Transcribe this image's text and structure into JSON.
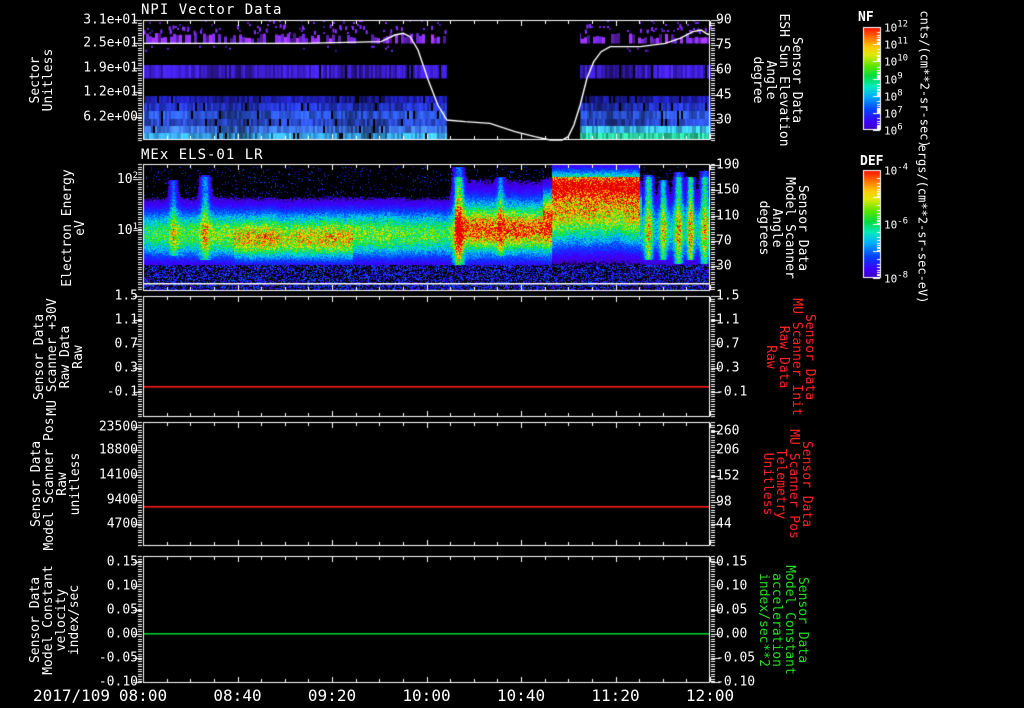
{
  "colors": {
    "background": "#000000",
    "axis": "#ffffff",
    "red_series": "#ff2222",
    "green_series": "#22dd44"
  },
  "x_axis": {
    "date_label": "2017/109",
    "tick_labels": [
      "08:00",
      "08:40",
      "09:20",
      "10:00",
      "10:40",
      "11:20",
      "12:00"
    ],
    "minor_ticks_per_major": 4
  },
  "chart_data": [
    {
      "id": "npi-vector-data",
      "type": "heatmap",
      "title": "NPI Vector Data",
      "y_left": {
        "title_lines": [
          "Sector",
          "Unitless"
        ],
        "ticks": [
          [
            "3.1e+01",
            0.0
          ],
          [
            "2.5e+01",
            0.192
          ],
          [
            "1.9e+01",
            0.4
          ],
          [
            "1.2e+01",
            0.6
          ],
          [
            "6.2e+00",
            0.808
          ]
        ]
      },
      "y_right": {
        "title_lines": [
          "Sensor Data",
          "ESH Sun Elevation",
          "Angle",
          "degree"
        ],
        "color": "#ffffff",
        "ticks": [
          [
            "90",
            0.0
          ],
          [
            "75",
            0.208
          ],
          [
            "60",
            0.417
          ],
          [
            "45",
            0.625
          ],
          [
            "30",
            0.833
          ]
        ]
      },
      "data_gap_time_frac": [
        0.536,
        0.771
      ],
      "overlay_line": {
        "name": "sun-elevation-angle",
        "color": "#ffffff",
        "units": "degree",
        "points_time_frac_deg": [
          [
            0,
            76
          ],
          [
            0.28,
            76
          ],
          [
            0.42,
            77
          ],
          [
            0.444,
            81
          ],
          [
            0.459,
            82
          ],
          [
            0.471,
            80
          ],
          [
            0.485,
            72
          ],
          [
            0.503,
            54
          ],
          [
            0.52,
            39
          ],
          [
            0.536,
            30
          ],
          [
            0.568,
            29
          ],
          [
            0.612,
            28
          ],
          [
            0.656,
            23
          ],
          [
            0.691,
            20
          ],
          [
            0.718,
            18
          ],
          [
            0.739,
            18
          ],
          [
            0.75,
            20
          ],
          [
            0.76,
            27
          ],
          [
            0.771,
            39
          ],
          [
            0.783,
            55
          ],
          [
            0.795,
            65
          ],
          [
            0.808,
            71
          ],
          [
            0.824,
            74
          ],
          [
            0.877,
            74
          ],
          [
            0.921,
            76
          ],
          [
            0.947,
            79
          ],
          [
            0.97,
            83
          ],
          [
            0.984,
            84
          ],
          [
            0.993,
            82
          ],
          [
            1.0,
            81
          ]
        ]
      },
      "bands": [
        {
          "y_frac": [
            0.0,
            0.105
          ],
          "style": "sparse-dots",
          "color": "#6a22dd"
        },
        {
          "y_frac": [
            0.108,
            0.196
          ],
          "style": "dashes",
          "color": "#7a2ae8"
        },
        {
          "y_frac": [
            0.215,
            0.25
          ],
          "style": "sparse-dots",
          "color": "#5a1ecc"
        },
        {
          "y_frac": [
            0.375,
            0.487
          ],
          "style": "noisy",
          "color": "#3c1ecc"
        },
        {
          "y_frac": [
            0.633,
            0.692
          ],
          "style": "noisy",
          "color": "#1d1daa"
        },
        {
          "y_frac": [
            0.692,
            0.758
          ],
          "style": "noisy",
          "color": "#2334c4"
        },
        {
          "y_frac": [
            0.758,
            0.825
          ],
          "style": "noisy",
          "color": "#2c55dc"
        },
        {
          "y_frac": [
            0.825,
            0.883
          ],
          "style": "noisy",
          "color": "#2a49cc"
        },
        {
          "y_frac": [
            0.883,
            0.942
          ],
          "style": "noisy",
          "color": "#3a70e2",
          "color_after_gap": "#38b8e8"
        },
        {
          "y_frac": [
            0.942,
            1.0
          ],
          "style": "noisy",
          "color": "#38a4ea",
          "color_after_gap": "#2ed8a4"
        }
      ]
    },
    {
      "id": "mex-els-01-lr",
      "type": "heatmap",
      "title": "MEx ELS-01 LR",
      "y_left": {
        "title_lines": [
          "Electron Energy",
          "eV"
        ],
        "ticks": [
          [
            "10^2",
            0.118
          ],
          [
            "10^1",
            0.52
          ]
        ]
      },
      "y_right": {
        "title_lines": [
          "Sensor Data",
          "Model Scanner",
          "Angle",
          "degrees"
        ],
        "color": "#ffffff",
        "ticks": [
          [
            "190",
            0.008
          ],
          [
            "150",
            0.205
          ],
          [
            "110",
            0.409
          ],
          [
            "70",
            0.606
          ],
          [
            "30",
            0.803
          ]
        ]
      },
      "features": {
        "core_segments": [
          {
            "x": [
              0,
              0.55
            ],
            "center": 0.55,
            "sigma": 0.125,
            "amp": 0.58
          },
          {
            "x": [
              0.55,
              0.72
            ],
            "center": 0.5,
            "sigma": 0.16,
            "amp": 0.62
          },
          {
            "x": [
              0.72,
              0.875
            ],
            "center": 0.45,
            "sigma": 0.15,
            "amp": 0.55
          },
          {
            "x": [
              0.875,
              1
            ],
            "center": 0.52,
            "sigma": 0.14,
            "amp": 0.36
          }
        ],
        "enhancements": [
          {
            "x": [
              0.16,
              0.37
            ],
            "center": 0.63,
            "sigma": 0.085,
            "amp": 0.22
          },
          {
            "x": [
              0.55,
              0.72
            ],
            "center": 0.52,
            "sigma": 0.09,
            "amp": 0.3
          },
          {
            "x": [
              0.72,
              0.875
            ],
            "center": 0.16,
            "sigma": 0.08,
            "amp": 1.05
          },
          {
            "x": [
              0.705,
              0.88
            ],
            "center": 0.33,
            "sigma": 0.09,
            "amp": 0.3
          }
        ],
        "stripes": [
          {
            "x": 0.053,
            "w": 0.005,
            "amp": 0.22,
            "y": [
              0.12,
              0.72
            ]
          },
          {
            "x": 0.109,
            "w": 0.006,
            "amp": 0.3,
            "y": [
              0.08,
              0.75
            ]
          },
          {
            "x": 0.556,
            "w": 0.006,
            "amp": 0.5,
            "y": [
              0.02,
              0.8
            ]
          },
          {
            "x": 0.63,
            "w": 0.004,
            "amp": 0.25,
            "y": [
              0.1,
              0.72
            ]
          },
          {
            "x": 0.891,
            "w": 0.005,
            "amp": 0.45,
            "y": [
              0.08,
              0.75
            ]
          },
          {
            "x": 0.917,
            "w": 0.004,
            "amp": 0.4,
            "y": [
              0.12,
              0.75
            ]
          },
          {
            "x": 0.944,
            "w": 0.005,
            "amp": 0.45,
            "y": [
              0.06,
              0.78
            ]
          },
          {
            "x": 0.965,
            "w": 0.004,
            "amp": 0.5,
            "y": [
              0.1,
              0.75
            ]
          },
          {
            "x": 0.99,
            "w": 0.005,
            "amp": 0.45,
            "y": [
              0.05,
              0.78
            ]
          }
        ],
        "bottom_noise_y": [
          0.788,
          0.995
        ],
        "white_line_y_frac": 0.937
      }
    },
    {
      "id": "mu-scanner-30v",
      "type": "line",
      "y_left": {
        "title_lines": [
          "Sensor Data",
          "MU Scanner +30V",
          "Raw Data",
          "Raw"
        ],
        "ticks": [
          [
            "1.5",
            0.0
          ],
          [
            "1.1",
            0.198
          ],
          [
            "0.7",
            0.397
          ],
          [
            "0.3",
            0.595
          ],
          [
            "-0.1",
            0.793
          ]
        ]
      },
      "y_right": {
        "title_lines": [
          "Sensor Data",
          "MU Scanner Init",
          "Raw Data",
          "Raw"
        ],
        "color": "#ff2222",
        "ticks": [
          [
            "1.5",
            0.0
          ],
          [
            "1.1",
            0.198
          ],
          [
            "0.7",
            0.397
          ],
          [
            "0.3",
            0.595
          ],
          [
            "-0.1",
            0.793
          ]
        ]
      },
      "series": [
        {
          "name": "raw-data",
          "color": "#ff1a1a",
          "value": 0.0,
          "y_frac": 0.752
        }
      ]
    },
    {
      "id": "model-scanner-pos",
      "type": "line",
      "y_left": {
        "title_lines": [
          "Sensor Data",
          "Model Scanner Pos",
          "Raw",
          "unitless"
        ],
        "ticks": [
          [
            "23500",
            0.04
          ],
          [
            "18800",
            0.225
          ],
          [
            "14100",
            0.427
          ],
          [
            "9400",
            0.63
          ],
          [
            "4700",
            0.82
          ]
        ]
      },
      "y_right": {
        "title_lines": [
          "Sensor Data",
          "MU Scanner Pos",
          "Telemetry",
          "Unitless"
        ],
        "color": "#ff2222",
        "ticks": [
          [
            "260",
            0.073
          ],
          [
            "206",
            0.225
          ],
          [
            "152",
            0.435
          ],
          [
            "98",
            0.645
          ],
          [
            "44",
            0.82
          ]
        ]
      },
      "series": [
        {
          "name": "scanner-pos",
          "color": "#ff1a1a",
          "value": 8100,
          "y_frac": 0.685
        }
      ]
    },
    {
      "id": "model-constant-velocity",
      "type": "line",
      "y_left": {
        "title_lines": [
          "Sensor Data",
          "Model Constant",
          "velocity",
          "index/sec"
        ],
        "ticks": [
          [
            "0.15",
            0.047
          ],
          [
            "0.10",
            0.236
          ],
          [
            "0.05",
            0.425
          ],
          [
            "0.00",
            0.614
          ],
          [
            "-0.05",
            0.803
          ],
          [
            "-0.10",
            0.992
          ]
        ]
      },
      "y_right": {
        "title_lines": [
          "Sensor Data",
          "Model Constant",
          "acceleration",
          "index/sec**2"
        ],
        "color": "#22dd22",
        "ticks": [
          [
            "0.15",
            0.047
          ],
          [
            "0.10",
            0.236
          ],
          [
            "0.05",
            0.425
          ],
          [
            "0.00",
            0.614
          ],
          [
            "-0.05",
            0.803
          ],
          [
            "-0.10",
            0.992
          ]
        ]
      },
      "series": [
        {
          "name": "model-constant",
          "color": "#00cc33",
          "value": 0.0,
          "y_frac": 0.614
        }
      ]
    }
  ],
  "colorbars": [
    {
      "name": "NF",
      "units": "cnts/(cm**2-sr-sec)",
      "tick_labels": [
        "10^12",
        "10^11",
        "10^10",
        "10^9",
        "10^8",
        "10^7",
        "10^6"
      ],
      "panel": 0
    },
    {
      "name": "DEF",
      "units": "ergs/(cm**2-sr-sec-eV)",
      "tick_labels": [
        "10^-4",
        "10^-6",
        "10^-8"
      ],
      "panel": 1
    }
  ]
}
